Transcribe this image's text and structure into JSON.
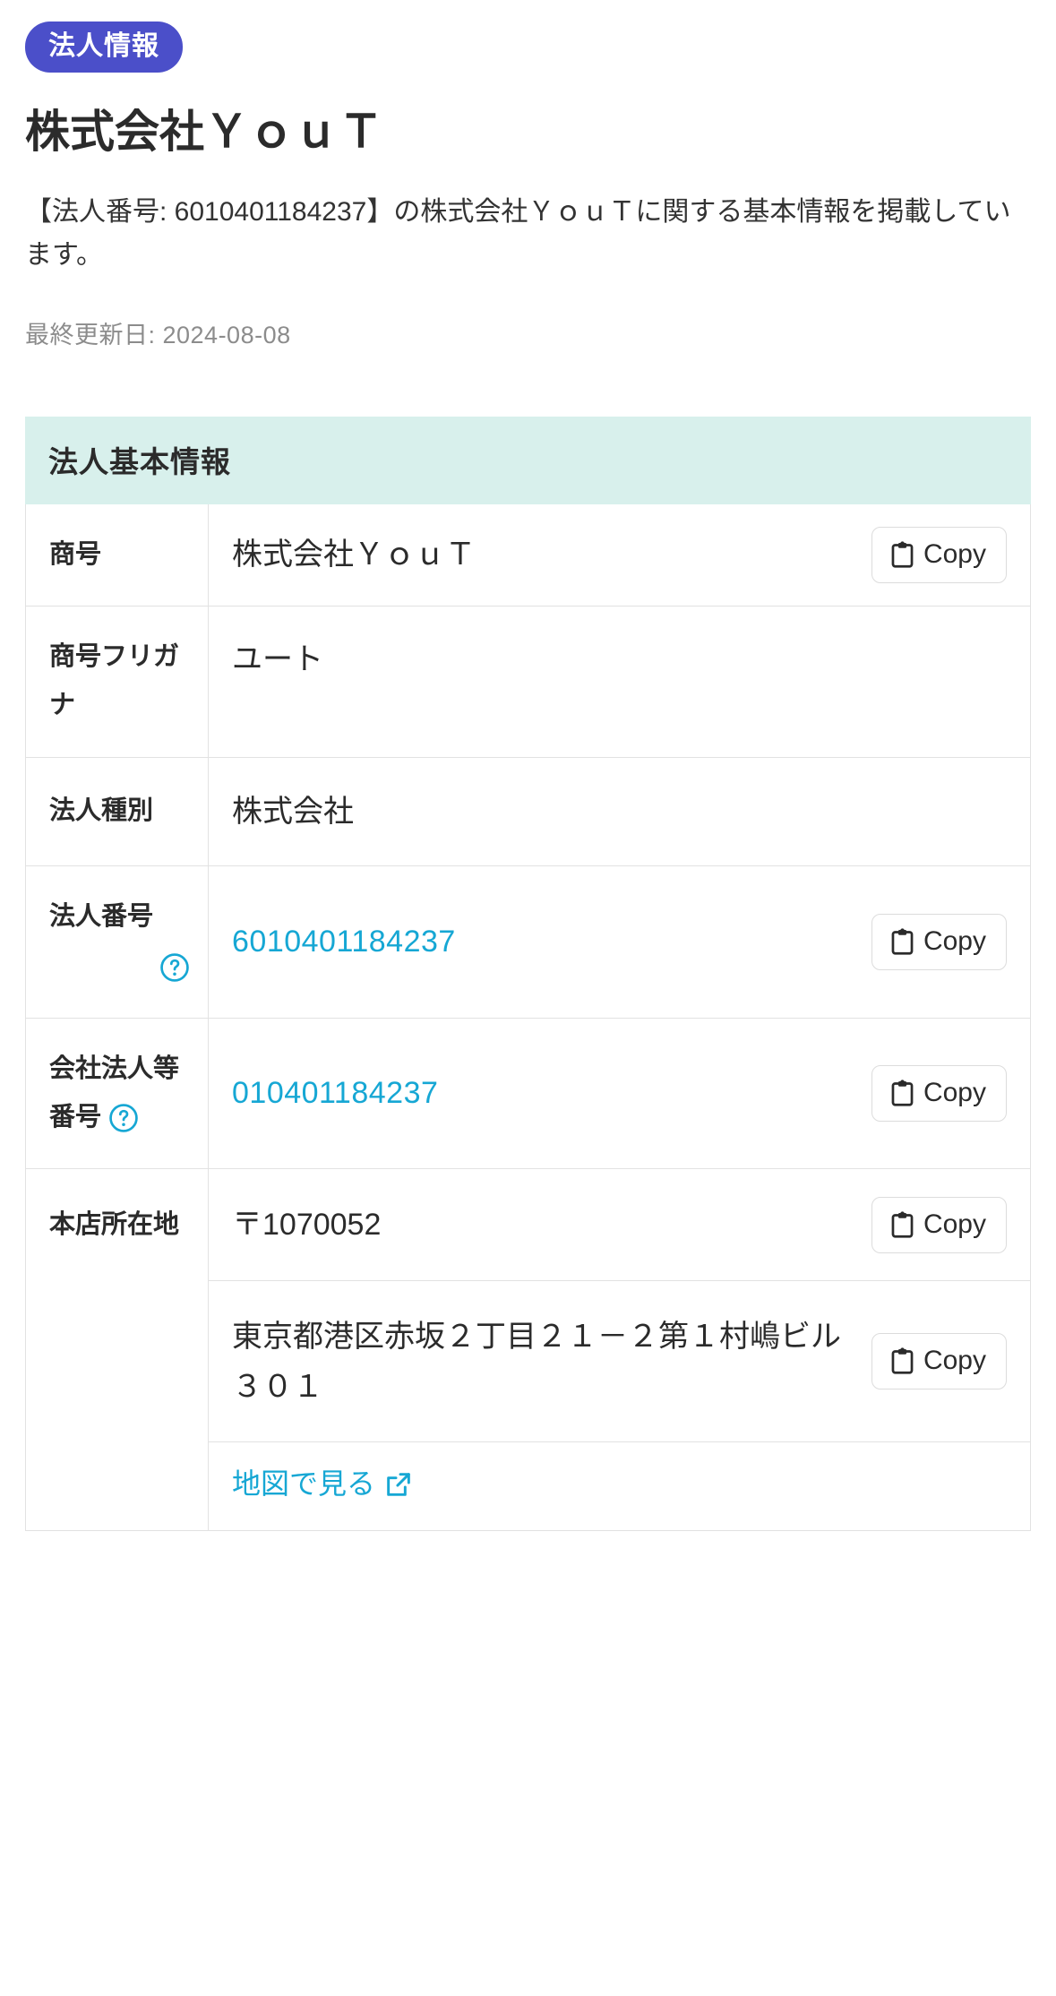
{
  "header": {
    "badge_label": "法人情報",
    "title": "株式会社ＹｏｕＴ",
    "lead": "【法人番号: 6010401184237】の株式会社ＹｏｕＴに関する基本情報を掲載しています。",
    "updated_label": "最終更新日: 2024-08-08"
  },
  "section": {
    "heading": "法人基本情報"
  },
  "labels": {
    "copy": "Copy",
    "help": "?",
    "map_link": "地図で見る"
  },
  "colors": {
    "badge_bg": "#4b4fc9",
    "section_bg": "#d8f0ec",
    "link": "#16a7d4",
    "text": "#2b2b2b",
    "muted": "#8c8c8c",
    "border": "#e2e2e2"
  },
  "rows": [
    {
      "label": "商号",
      "value": "株式会社ＹｏｕＴ",
      "type": "text",
      "copy": true
    },
    {
      "label": "商号フリガナ",
      "value": "ユート",
      "type": "text",
      "copy": false
    },
    {
      "label": "法人種別",
      "value": "株式会社",
      "type": "text",
      "copy": false
    },
    {
      "label": "法人番号",
      "value": "6010401184237",
      "type": "link",
      "copy": true,
      "help": true
    },
    {
      "label": "会社法人等番号",
      "value": "010401184237",
      "type": "link",
      "copy": true,
      "help": true
    },
    {
      "label": "本店所在地",
      "postal": "〒1070052",
      "address": "東京都港区赤坂２丁目２１－２第１村嶋ビル３０１",
      "type": "address",
      "copy": true,
      "map": true
    }
  ]
}
